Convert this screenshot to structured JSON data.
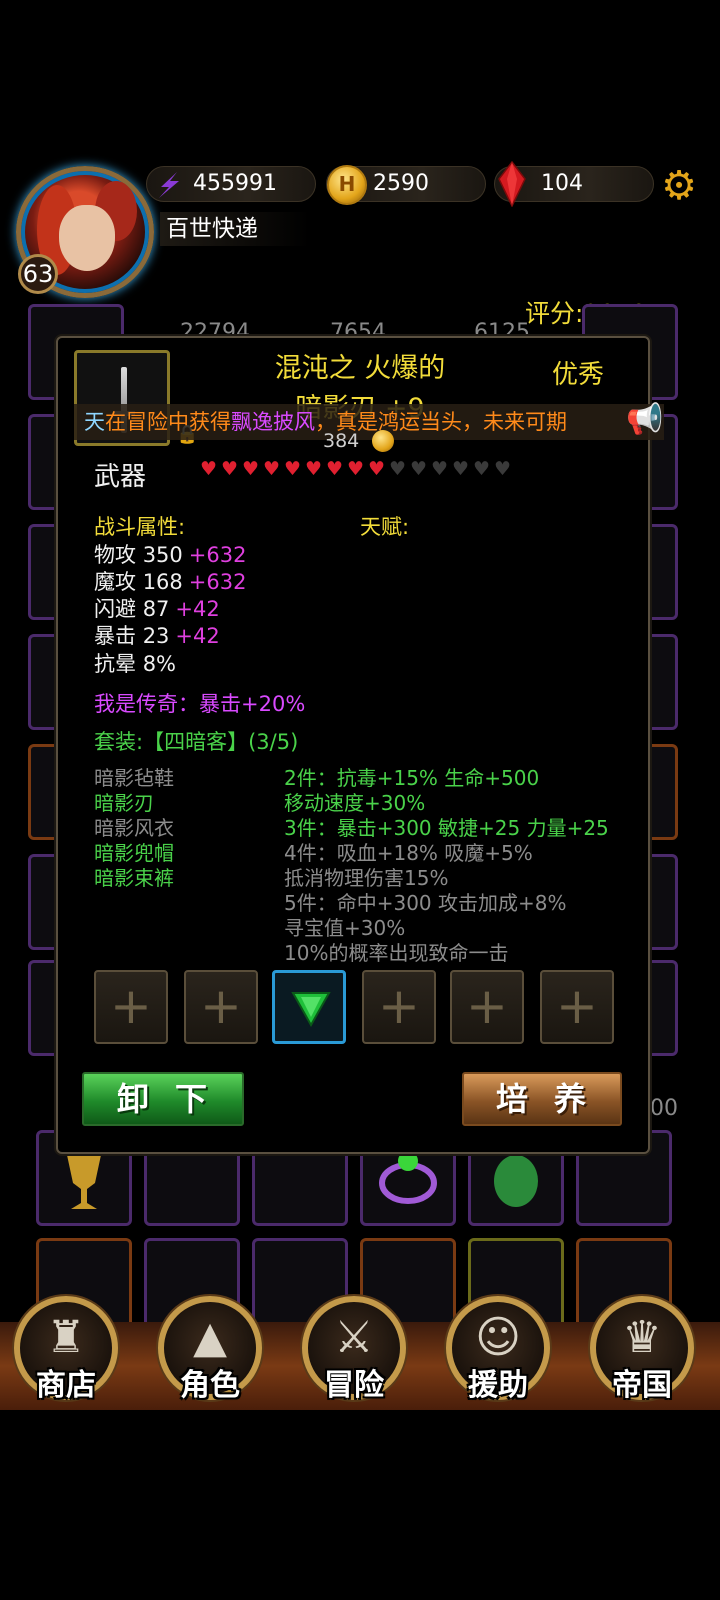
{
  "player": {
    "name": "百世快递",
    "level": "63",
    "score": "评分:3079"
  },
  "resources": {
    "exp": "455991",
    "gold": "2590",
    "gems": "104"
  },
  "item": {
    "name_line1": "混沌之 火爆的",
    "name_line2": "暗影刃 +9",
    "quality": "优秀",
    "price": "384",
    "category": "武器",
    "hearts_total": 15,
    "hearts_filled": 9
  },
  "marquee": {
    "prefix": "天",
    "part1": "在冒险中获得",
    "item_name": "飘逸披风",
    "part2": "，真是鸿运当头，未来可期"
  },
  "stats": {
    "combat_label": "战斗属性:",
    "talent_label": "天赋:",
    "rows": [
      {
        "name": "物攻",
        "base": "350",
        "bonus": "+632"
      },
      {
        "name": "魔攻",
        "base": "168",
        "bonus": "+632"
      },
      {
        "name": "闪避",
        "base": "87",
        "bonus": "+42"
      },
      {
        "name": "暴击",
        "base": "23",
        "bonus": "+42"
      },
      {
        "name": "抗晕",
        "base": "8%",
        "bonus": ""
      }
    ]
  },
  "legend_text": "我是传奇：暴击+20%",
  "set": {
    "title": "套装:【四暗客】(3/5)",
    "pieces": [
      {
        "name": "暗影毡鞋",
        "owned": false
      },
      {
        "name": "暗影刃",
        "owned": true
      },
      {
        "name": "暗影风衣",
        "owned": false
      },
      {
        "name": "暗影兜帽",
        "owned": true
      },
      {
        "name": "暗影束裤",
        "owned": true
      }
    ],
    "bonuses": [
      {
        "text": "2件：抗毒+15% 生命+500",
        "active": true
      },
      {
        "text": "移动速度+30%",
        "active": true
      },
      {
        "text": "3件：暴击+300 敏捷+25 力量+25",
        "active": true
      },
      {
        "text": "4件：吸血+18% 吸魔+5%",
        "active": false
      },
      {
        "text": "抵消物理伤害15%",
        "active": false
      },
      {
        "text": "5件：命中+300 攻击加成+8%",
        "active": false
      },
      {
        "text": "寻宝值+30%",
        "active": false
      },
      {
        "text": "10%的概率出现致命一击",
        "active": false
      }
    ]
  },
  "sockets": {
    "plus_symbol": "+",
    "slots": [
      "empty",
      "empty",
      "gem",
      "empty",
      "empty",
      "empty"
    ]
  },
  "buttons": {
    "unequip": "卸下",
    "train": "培养"
  },
  "background": {
    "stat1": "22794",
    "stat2": "7654",
    "stat3": "6125",
    "stat4": "00"
  },
  "nav": [
    {
      "label": "商店",
      "icon": "castle-icon"
    },
    {
      "label": "角色",
      "icon": "hooded-figure-icon"
    },
    {
      "label": "冒险",
      "icon": "dungeon-gate-icon"
    },
    {
      "label": "援助",
      "icon": "ally-portrait-icon"
    },
    {
      "label": "帝国",
      "icon": "crown-icon"
    }
  ],
  "colors": {
    "title_yellow": "#f2dc3a",
    "bonus_magenta": "#e040e0",
    "set_green": "#4ad24a",
    "heart_red": "#e02030"
  }
}
